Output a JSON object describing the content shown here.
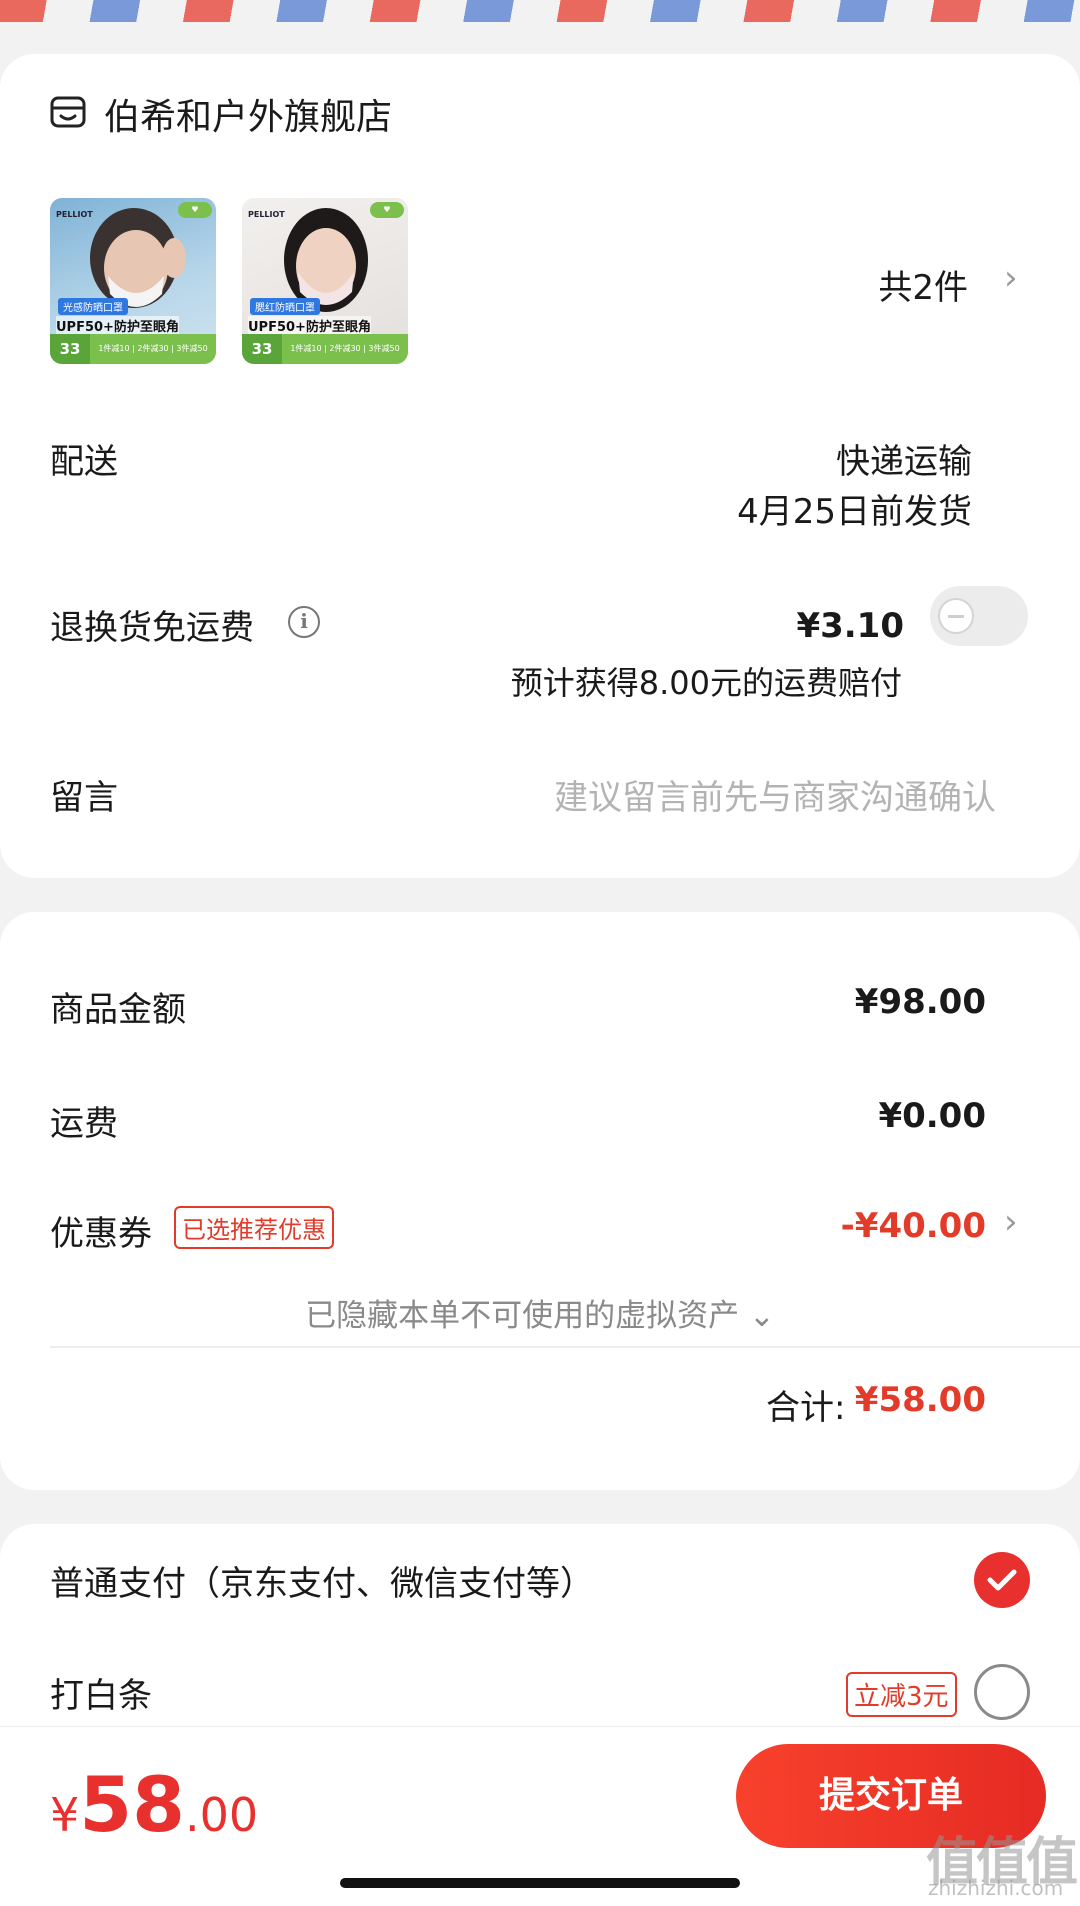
{
  "store": {
    "name": "伯希和户外旗舰店",
    "products": [
      {
        "brand": "PELLIOT",
        "tag": "光感防晒口罩",
        "headline": "UPF50+防护至眼角",
        "price": "33",
        "promo": "1件减10 | 2件减30 | 3件减50",
        "photo_bg": "#9fc6df"
      },
      {
        "brand": "PELLIOT",
        "tag": "腮红防晒口罩",
        "headline": "UPF50+防护至眼角",
        "price": "33",
        "promo": "1件减10 | 2件减30 | 3件减50",
        "photo_bg": "#e9e6e4"
      }
    ],
    "count_label": "共2件",
    "delivery_label": "配送",
    "delivery_method": "快递运输",
    "delivery_date": "4月25日前发货",
    "return_shipping_label": "退换货免运费",
    "return_shipping_price": "¥3.10",
    "return_shipping_note": "预计获得8.00元的运费赔付",
    "return_shipping_enabled": false,
    "message_label": "留言",
    "message_placeholder": "建议留言前先与商家沟通确认"
  },
  "summary": {
    "goods_label": "商品金额",
    "goods_value": "¥98.00",
    "shipping_label": "运费",
    "shipping_value": "¥0.00",
    "coupon_label": "优惠券",
    "coupon_badge": "已选推荐优惠",
    "coupon_value": "-¥40.00",
    "hidden_assets": "已隐藏本单不可使用的虚拟资产 ⌄",
    "total_label": "合计:",
    "total_value": "¥58.00"
  },
  "payment": {
    "normal_label": "普通支付（京东支付、微信支付等）",
    "normal_selected": true,
    "baitiao_label": "打白条",
    "baitiao_badge": "立减3元",
    "baitiao_selected": false
  },
  "footer": {
    "currency": "¥",
    "total_int": "58",
    "total_dec": ".00",
    "submit_label": "提交订单"
  },
  "watermark": {
    "text": "值值值",
    "sub": "zhizhizhi.com"
  },
  "colors": {
    "accent_red": "#e8302e",
    "placeholder_gray": "#b3b3b3"
  }
}
